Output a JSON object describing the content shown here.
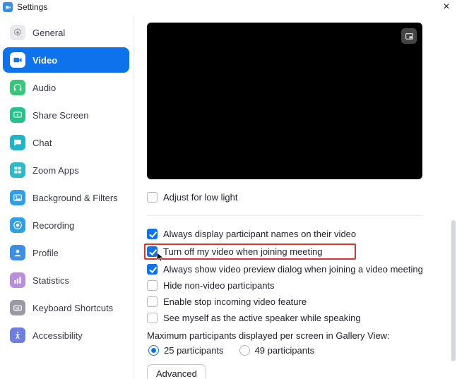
{
  "window": {
    "title": "Settings"
  },
  "sidebar": {
    "items": [
      {
        "label": "General",
        "icon": "gear-icon",
        "bg": "#e9e9ee"
      },
      {
        "label": "Video",
        "icon": "video-icon",
        "bg": "#0e72ed",
        "active": true
      },
      {
        "label": "Audio",
        "icon": "headphones-icon",
        "bg": "#37c77b"
      },
      {
        "label": "Share Screen",
        "icon": "share-screen-icon",
        "bg": "#24c28a"
      },
      {
        "label": "Chat",
        "icon": "chat-icon",
        "bg": "#1fb5c9"
      },
      {
        "label": "Zoom Apps",
        "icon": "apps-icon",
        "bg": "#2fb8c8"
      },
      {
        "label": "Background & Filters",
        "icon": "background-icon",
        "bg": "#2f9fe8"
      },
      {
        "label": "Recording",
        "icon": "recording-icon",
        "bg": "#2f9fe8"
      },
      {
        "label": "Profile",
        "icon": "profile-icon",
        "bg": "#3a8ee6"
      },
      {
        "label": "Statistics",
        "icon": "statistics-icon",
        "bg": "#b98edb"
      },
      {
        "label": "Keyboard Shortcuts",
        "icon": "keyboard-icon",
        "bg": "#999aa5"
      },
      {
        "label": "Accessibility",
        "icon": "accessibility-icon",
        "bg": "#6d7de0"
      }
    ]
  },
  "video": {
    "adjust_low_light": {
      "label": "Adjust for low light",
      "checked": false
    },
    "options": [
      {
        "label": "Always display participant names on their video",
        "checked": true,
        "highlight": false
      },
      {
        "label": "Turn off my video when joining meeting",
        "checked": true,
        "highlight": true
      },
      {
        "label": "Always show video preview dialog when joining a video meeting",
        "checked": true,
        "highlight": false
      },
      {
        "label": "Hide non-video participants",
        "checked": false,
        "highlight": false
      },
      {
        "label": "Enable stop incoming video feature",
        "checked": false,
        "highlight": false
      },
      {
        "label": "See myself as the active speaker while speaking",
        "checked": false,
        "highlight": false
      }
    ],
    "gallery": {
      "label": "Maximum participants displayed per screen in Gallery View:",
      "choices": [
        {
          "label": "25 participants",
          "checked": true
        },
        {
          "label": "49 participants",
          "checked": false
        }
      ]
    },
    "advanced_label": "Advanced"
  }
}
